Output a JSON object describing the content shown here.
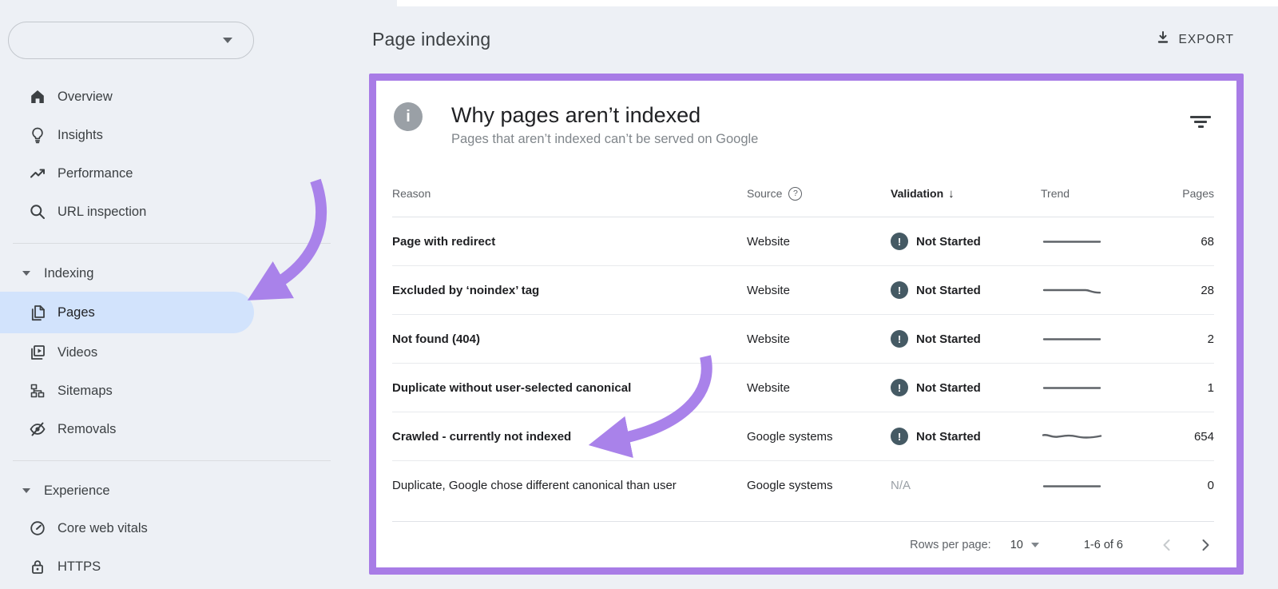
{
  "colors": {
    "page_bg": "#edf0f5",
    "accent_purple": "#a87fe8",
    "selected_item_bg": "#d2e3fc",
    "badge_bg": "#455a64"
  },
  "icons": {
    "info_glyph": "i",
    "help_glyph": "?",
    "badge_glyph": "!",
    "sort_desc_glyph": "↓"
  },
  "sidebar": {
    "nav_top": [
      {
        "icon": "home-icon",
        "label": "Overview"
      },
      {
        "icon": "lightbulb-icon",
        "label": "Insights"
      },
      {
        "icon": "trending-up-icon",
        "label": "Performance"
      },
      {
        "icon": "search-icon",
        "label": "URL inspection"
      }
    ],
    "sections": [
      {
        "label": "Indexing",
        "items": [
          {
            "icon": "pages-icon",
            "label": "Pages",
            "selected": true
          },
          {
            "icon": "videos-icon",
            "label": "Videos",
            "selected": false
          },
          {
            "icon": "sitemaps-icon",
            "label": "Sitemaps",
            "selected": false
          },
          {
            "icon": "eye-off-icon",
            "label": "Removals",
            "selected": false
          }
        ]
      },
      {
        "label": "Experience",
        "items": [
          {
            "icon": "speedometer-icon",
            "label": "Core web vitals",
            "selected": false
          },
          {
            "icon": "lock-icon",
            "label": "HTTPS",
            "selected": false
          }
        ]
      }
    ]
  },
  "header": {
    "title": "Page indexing",
    "export_label": "EXPORT"
  },
  "card": {
    "title": "Why pages aren’t indexed",
    "subtitle": "Pages that aren’t indexed can’t be served on Google",
    "columns": {
      "reason": "Reason",
      "source": "Source",
      "validation": "Validation",
      "trend": "Trend",
      "pages": "Pages"
    },
    "rows": [
      {
        "reason": "Page with redirect",
        "source": "Website",
        "validation": "Not Started",
        "trend": "flat",
        "pages": "68",
        "bold": true
      },
      {
        "reason": "Excluded by ‘noindex’ tag",
        "source": "Website",
        "validation": "Not Started",
        "trend": "dip",
        "pages": "28",
        "bold": true
      },
      {
        "reason": "Not found (404)",
        "source": "Website",
        "validation": "Not Started",
        "trend": "flat",
        "pages": "2",
        "bold": true
      },
      {
        "reason": "Duplicate without user-selected canonical",
        "source": "Website",
        "validation": "Not Started",
        "trend": "flat",
        "pages": "1",
        "bold": true
      },
      {
        "reason": "Crawled - currently not indexed",
        "source": "Google systems",
        "validation": "Not Started",
        "trend": "wavy",
        "pages": "654",
        "bold": true
      },
      {
        "reason": "Duplicate, Google chose different canonical than user",
        "source": "Google systems",
        "validation": "N/A",
        "trend": "flat",
        "pages": "0",
        "bold": false
      }
    ],
    "footer": {
      "rows_per_page_label": "Rows per page:",
      "rows_per_page_value": "10",
      "range": "1-6 of 6"
    }
  }
}
